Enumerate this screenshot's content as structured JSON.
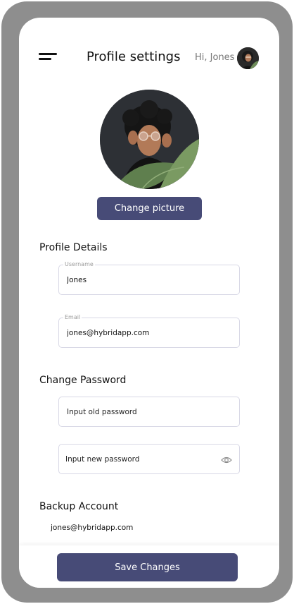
{
  "header": {
    "title": "Profile settings",
    "greeting": "Hi, Jones"
  },
  "profile": {
    "change_picture_label": "Change picture"
  },
  "profile_details": {
    "heading": "Profile Details",
    "username": {
      "label": "Username",
      "value": "Jones"
    },
    "email": {
      "label": "Email",
      "value": "jones@hybridapp.com"
    }
  },
  "change_password": {
    "heading": "Change Password",
    "old_placeholder": "Input old password",
    "new_placeholder": "Input new password"
  },
  "backup": {
    "heading": "Backup Account",
    "email": "jones@hybridapp.com"
  },
  "footer": {
    "save_label": "Save Changes"
  },
  "colors": {
    "primary": "#474b77",
    "frame": "#8e8e8e",
    "field_border": "#d8d8e6"
  },
  "icons": {
    "menu": "menu-icon",
    "eye": "eye-icon"
  }
}
